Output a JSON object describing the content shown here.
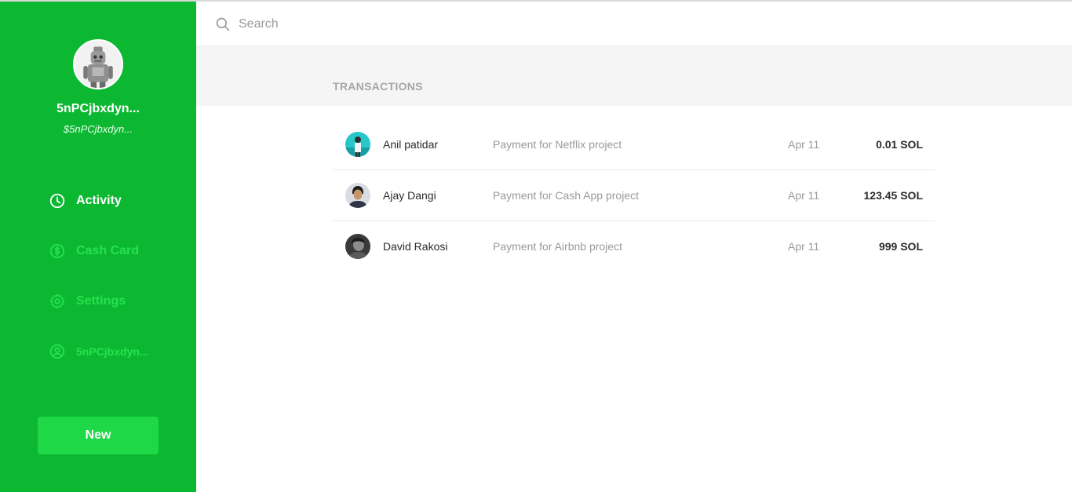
{
  "profile": {
    "username": "5nPCjbxdyn...",
    "cashtag": "$5nPCjbxdyn...",
    "avatar_icon": "robot-avatar"
  },
  "nav": {
    "activity": {
      "label": "Activity",
      "icon": "clock-icon"
    },
    "cash_card": {
      "label": "Cash Card",
      "icon": "dollar-circle-icon"
    },
    "settings": {
      "label": "Settings",
      "icon": "gear-icon"
    },
    "account": {
      "label": "5nPCjbxdyn...",
      "icon": "user-circle-icon"
    }
  },
  "new_button": {
    "label": "New"
  },
  "search": {
    "placeholder": "Search",
    "value": ""
  },
  "transactions": {
    "title": "TRANSACTIONS",
    "rows": [
      {
        "name": "Anil patidar",
        "description": "Payment for Netflix project",
        "date": "Apr 11",
        "amount": "0.01 SOL"
      },
      {
        "name": "Ajay Dangi",
        "description": "Payment for Cash App project",
        "date": "Apr 11",
        "amount": "123.45 SOL"
      },
      {
        "name": "David Rakosi",
        "description": "Payment for Airbnb project",
        "date": "Apr 11",
        "amount": "999 SOL"
      }
    ]
  },
  "colors": {
    "sidebar": "#0cb832",
    "nav_inactive": "#26e24e",
    "button": "#1fd848"
  }
}
